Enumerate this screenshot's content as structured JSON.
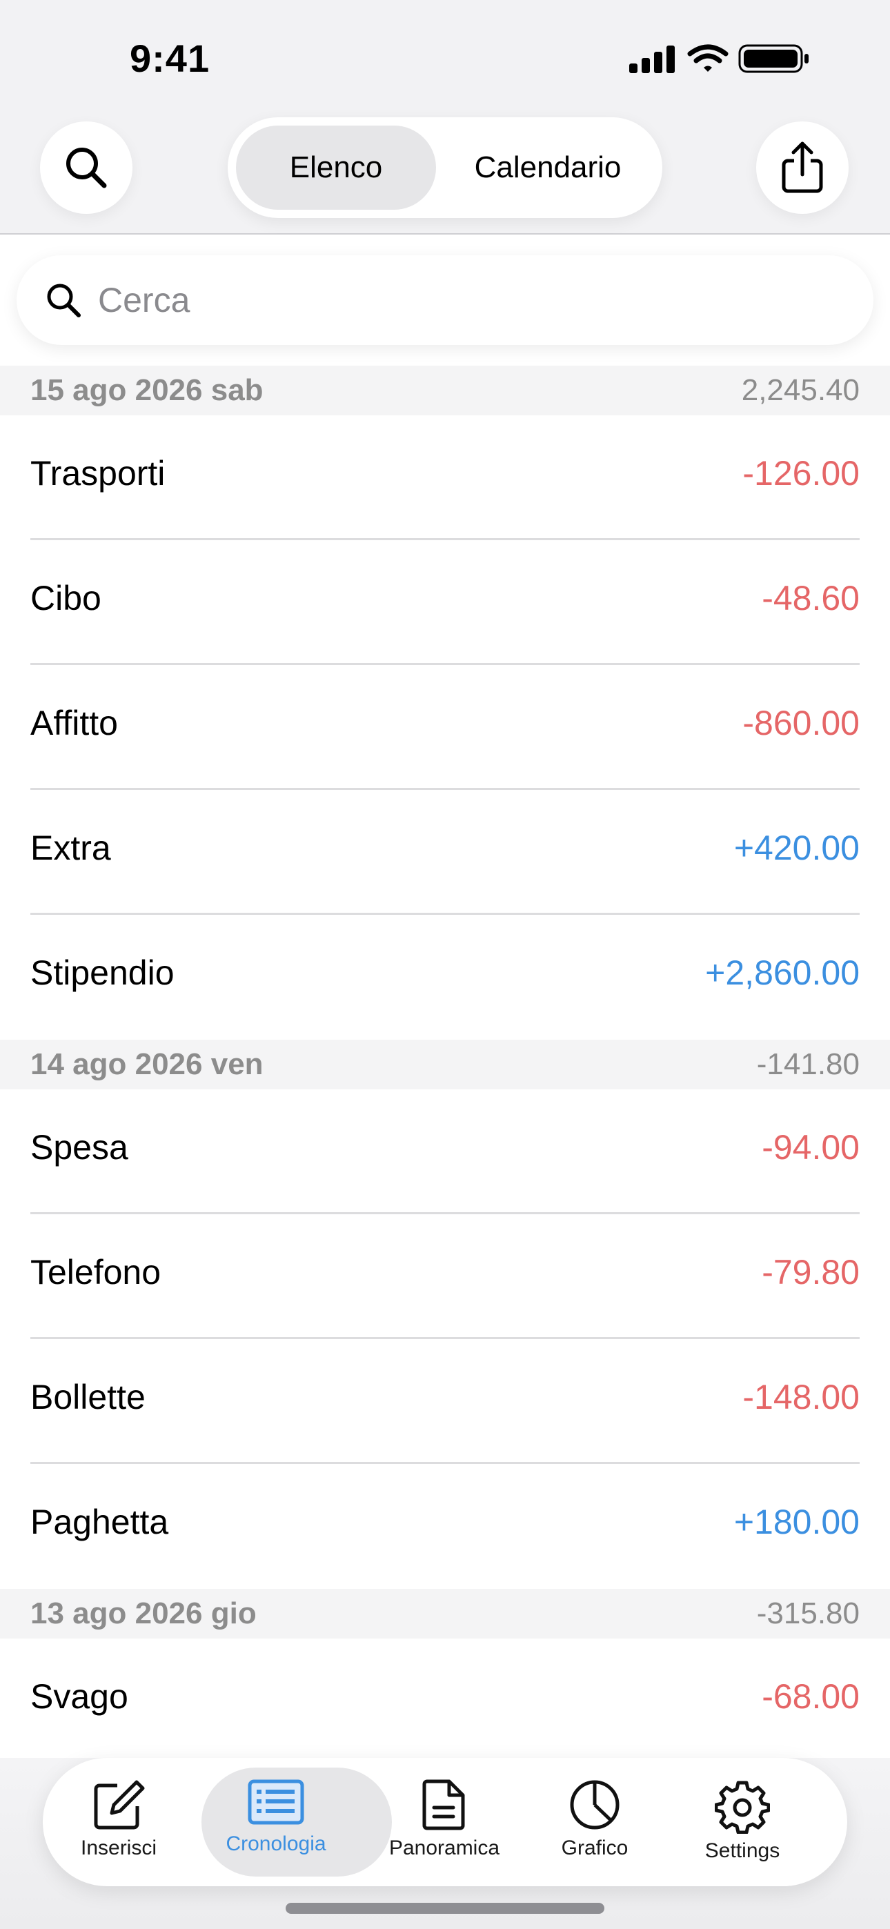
{
  "status_bar": {
    "time": "9:41"
  },
  "header": {
    "segments": [
      {
        "label": "Elenco",
        "selected": true
      },
      {
        "label": "Calendario",
        "selected": false
      }
    ],
    "search_icon": "search-icon",
    "share_icon": "share-icon"
  },
  "search": {
    "placeholder": "Cerca"
  },
  "colors": {
    "negative": "#e56667",
    "positive": "#3b8fe0",
    "accent": "#3b8fe0"
  },
  "groups": [
    {
      "date": "15 ago 2026 sab",
      "total": "2,245.40",
      "items": [
        {
          "category": "Trasporti",
          "amount": "-126.00",
          "kind": "neg"
        },
        {
          "category": "Cibo",
          "amount": "-48.60",
          "kind": "neg"
        },
        {
          "category": "Affitto",
          "amount": "-860.00",
          "kind": "neg"
        },
        {
          "category": "Extra",
          "amount": "+420.00",
          "kind": "pos"
        },
        {
          "category": "Stipendio",
          "amount": "+2,860.00",
          "kind": "pos"
        }
      ]
    },
    {
      "date": "14 ago 2026 ven",
      "total": "-141.80",
      "items": [
        {
          "category": "Spesa",
          "amount": "-94.00",
          "kind": "neg"
        },
        {
          "category": "Telefono",
          "amount": "-79.80",
          "kind": "neg"
        },
        {
          "category": "Bollette",
          "amount": "-148.00",
          "kind": "neg"
        },
        {
          "category": "Paghetta",
          "amount": "+180.00",
          "kind": "pos"
        }
      ]
    },
    {
      "date": "13 ago 2026 gio",
      "total": "-315.80",
      "items": [
        {
          "category": "Svago",
          "amount": "-68.00",
          "kind": "neg"
        }
      ]
    }
  ],
  "tab_bar": {
    "tabs": [
      {
        "label": "Inserisci",
        "icon": "compose-icon",
        "active": false
      },
      {
        "label": "Cronologia",
        "icon": "list-icon",
        "active": true
      },
      {
        "label": "Panoramica",
        "icon": "document-icon",
        "active": false
      },
      {
        "label": "Grafico",
        "icon": "pie-chart-icon",
        "active": false
      },
      {
        "label": "Settings",
        "icon": "gear-icon",
        "active": false
      }
    ]
  }
}
